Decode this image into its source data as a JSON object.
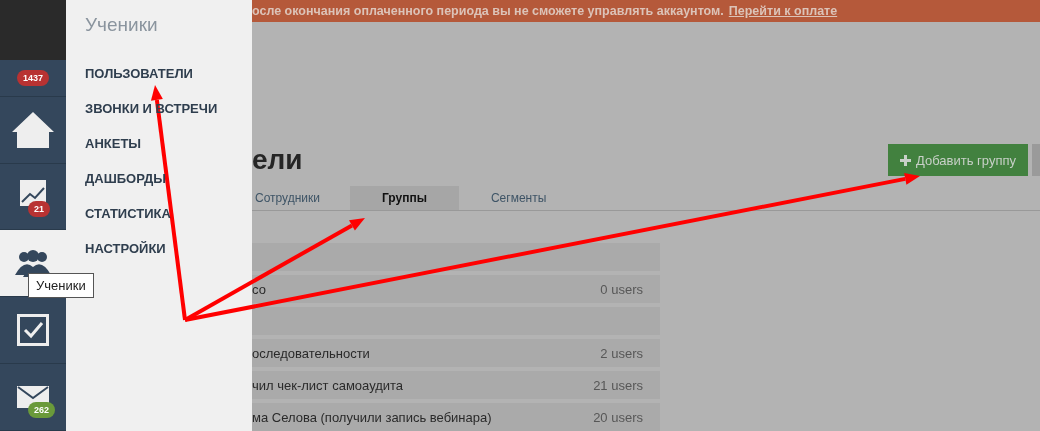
{
  "profile": {
    "badge": "1437"
  },
  "rail": [
    {
      "kind": "home",
      "selected": false
    },
    {
      "kind": "chart",
      "selected": false,
      "badge": "21",
      "color": "#b83232"
    },
    {
      "kind": "users",
      "selected": true,
      "tooltip": "Ученики"
    },
    {
      "kind": "check",
      "selected": false
    },
    {
      "kind": "mail",
      "selected": false,
      "badge": "262",
      "color": "#6a9a3a"
    }
  ],
  "menu": {
    "title": "Ученики",
    "items": [
      "ПОЛЬЗОВАТЕЛИ",
      "ЗВОНКИ И ВСТРЕЧИ",
      "АНКЕТЫ",
      "ДАШБОРДЫ",
      "СТАТИСТИКА",
      "НАСТРОЙКИ"
    ]
  },
  "banner": {
    "text": "осле окончания оплаченного периода вы не сможете управлять аккаунтом.",
    "link": "Перейти к оплате"
  },
  "page": {
    "title": "ели",
    "add_button": "Добавить группу",
    "tabs": [
      {
        "label": "Сотрудники",
        "selected": false
      },
      {
        "label": "Группы",
        "selected": true
      },
      {
        "label": "Сегменты",
        "selected": false
      }
    ],
    "rows": [
      {
        "kind": "blank"
      },
      {
        "kind": "group",
        "name": "со",
        "count": "0 users"
      },
      {
        "kind": "blank"
      },
      {
        "kind": "group",
        "name": "оследовательности",
        "count": "2 users"
      },
      {
        "kind": "group",
        "name": "чил чек-лист самоаудита",
        "count": "21 users"
      },
      {
        "kind": "group",
        "name": "ма Селова (получили запись вебинара)",
        "count": "20 users"
      }
    ]
  }
}
